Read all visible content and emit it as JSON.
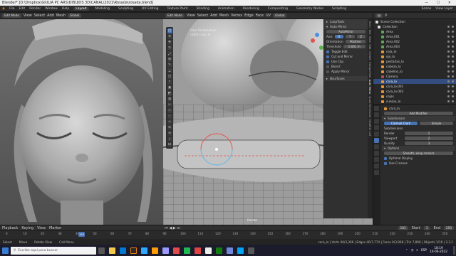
{
  "window": {
    "title": "Blender* [D:\\Dropbox\\GIULIA PC ARS\\DIBUJOS 3D\\CANAL\\2021\\Rosada\\rosada.blend]",
    "controls": "— ☐ ✕"
  },
  "menu": {
    "items": [
      "File",
      "Edit",
      "Render",
      "Window",
      "Help"
    ],
    "workspaces": [
      "Layout",
      "Modeling",
      "Sculpting",
      "UV Editing",
      "Texture Paint",
      "Shading",
      "Animation",
      "Rendering",
      "Compositing",
      "Geometry Nodes",
      "Scripting"
    ],
    "active_workspace": "Layout",
    "scene": "Scene",
    "view_layer": "View Layer"
  },
  "left_viewport": {
    "mode": "Edit Mode",
    "view": "View",
    "select": "Select",
    "add": "Add",
    "mesh": "Mesh",
    "transform": "Global"
  },
  "main_viewport": {
    "mode": "Edit Mode",
    "view": "View",
    "select": "Select",
    "add": "Add",
    "mesh": "Mesh",
    "vertex": "Vertex",
    "edge": "Edge",
    "face": "Face",
    "uv": "UV",
    "transform": "Global",
    "viewinfo_line1": "User Perspective",
    "viewinfo_line2": "(183) cara_lo",
    "hint": "Rotate"
  },
  "npanel": {
    "section_loop": "LoopTools",
    "section_auto_mirror": "Auto Mirror",
    "automirror_button": "AutoMirror",
    "axis_label": "Axis",
    "axes": [
      "X",
      "Y",
      "Z"
    ],
    "orientation_label": "Orientation",
    "orientation": "Positive",
    "threshold_label": "Threshold",
    "threshold": "0.001 m",
    "toggle_edit": "Toggle Edit",
    "cut_mirror": "Cut and Mirror",
    "use_clip": "Use Clip",
    "bisect": "Bisect",
    "apply_mirror": "Apply Mirror",
    "section_bsurfaces": "Bsurfaces",
    "tabs": [
      "Item",
      "Tool",
      "View",
      "Edit",
      "Create",
      "RetopoFlow",
      "Auto Mirror",
      "Quad Remesher",
      "Modifier List"
    ]
  },
  "outliner": {
    "header": "Scene Collection",
    "items": [
      {
        "label": "Collection",
        "selected": false,
        "type": "collection"
      },
      {
        "label": "Area",
        "selected": false,
        "type": "light"
      },
      {
        "label": "Area.001",
        "selected": false,
        "type": "light"
      },
      {
        "label": "Area.002",
        "selected": false,
        "type": "light"
      },
      {
        "label": "Area.003",
        "selected": false,
        "type": "light"
      },
      {
        "label": "ceja_lo",
        "selected": false,
        "type": "mesh"
      },
      {
        "label": "ojo_lo",
        "selected": false,
        "type": "mesh"
      },
      {
        "label": "pestañas_lo",
        "selected": false,
        "type": "mesh"
      },
      {
        "label": "cabeza_lo",
        "selected": false,
        "type": "mesh"
      },
      {
        "label": "cabellos_lo",
        "selected": false,
        "type": "mesh"
      },
      {
        "label": "Camera",
        "selected": false,
        "type": "camera"
      },
      {
        "label": "cara_lo",
        "selected": true,
        "type": "mesh"
      },
      {
        "label": "cara_lo.001",
        "selected": false,
        "type": "mesh"
      },
      {
        "label": "cara_lo.003",
        "selected": false,
        "type": "mesh"
      },
      {
        "label": "cejas",
        "selected": false,
        "type": "mesh"
      },
      {
        "label": "cuerpo_lo",
        "selected": false,
        "type": "mesh"
      },
      {
        "label": "rubor_lo",
        "selected": false,
        "type": "mesh"
      }
    ]
  },
  "properties": {
    "object_name": "cara_lo",
    "add_modifier": "Add Modifier",
    "modifier_name": "Subdivision",
    "catmull_clark": "Catmull-Clark",
    "simple": "Simple",
    "levels_label": "Subdivisions",
    "render_label": "Render",
    "render_value": "2",
    "viewport_label": "Viewport",
    "viewport_value": "2",
    "quality_label": "Quality",
    "quality_value": "3",
    "options_label": "Options",
    "uv_smooth": "Smooth, keep corners",
    "optimal_display": "Optimal Display",
    "use_creases": "Use Creases"
  },
  "timeline": {
    "playback": "Playback",
    "keying": "Keying",
    "view": "View",
    "marker": "Marker",
    "current_frame": "183",
    "start_label": "Start",
    "start": "1",
    "end_label": "End",
    "end": "250",
    "ticks": [
      "0",
      "10",
      "20",
      "30",
      "40",
      "50",
      "60",
      "70",
      "80",
      "90",
      "100",
      "110",
      "120",
      "130",
      "140",
      "150",
      "160",
      "170",
      "180",
      "190",
      "200",
      "210",
      "220",
      "230",
      "240",
      "250"
    ]
  },
  "statusbar": {
    "select": "Select",
    "move": "Move",
    "rotate_view": "Rotate View",
    "context_menu": "Call Menu",
    "stats": "cara_lo | Verts 40/3,366 | Edges 40/7,774 | Faces 0/3,908 | Tris 7,806 | Objects 1/16 | 3.3.1"
  },
  "taskbar": {
    "search_placeholder": "Escribe aquí para buscar",
    "lang": "ESP",
    "time": "18:19",
    "date": "10-06-2022"
  },
  "colors": {
    "accent": "#4772b3",
    "selected_row": "#334d80",
    "mesh_orange": "#e3953a"
  }
}
